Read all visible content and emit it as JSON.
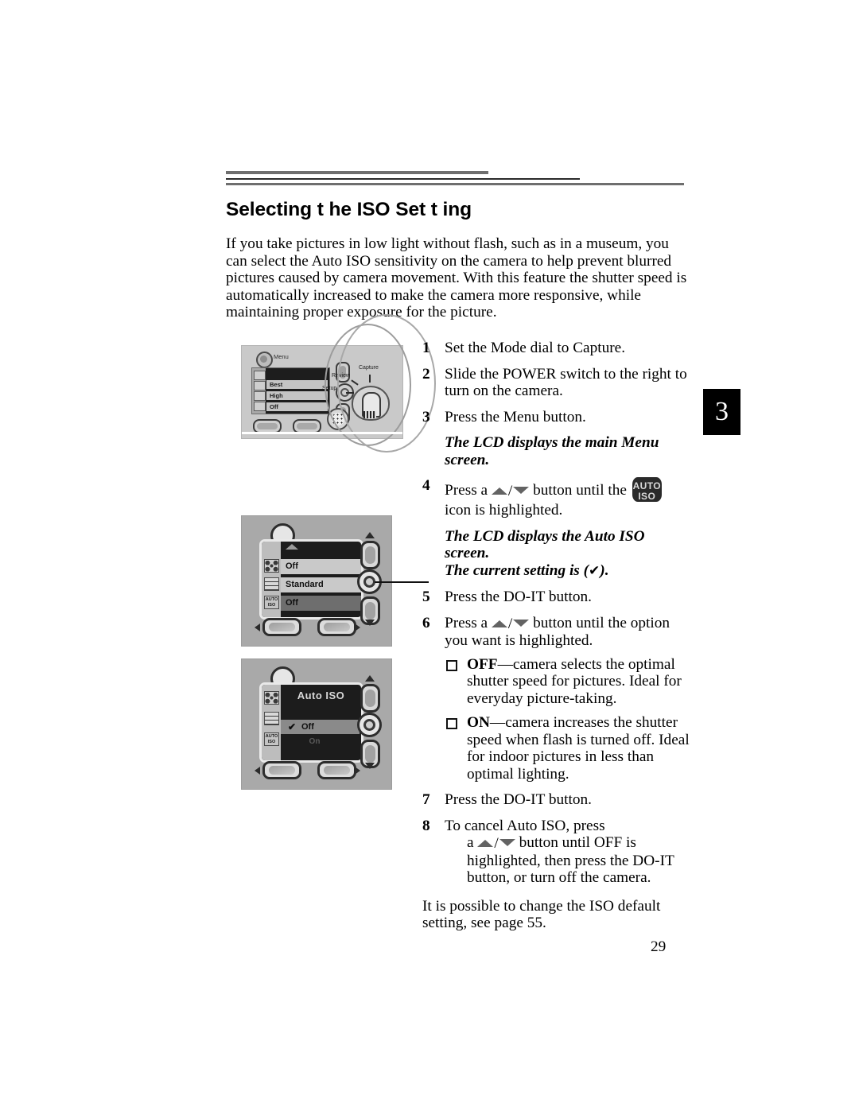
{
  "document": {
    "title": "Selecting t he ISO Set t ing",
    "page_number": "29",
    "chapter_tab": "3",
    "intro": "If you take pictures in low light without flash, such as in a museum, you can select the Auto ISO sensitivity on the camera to help prevent blurred pictures caused by camera movement. With this feature the shutter speed is automatically increased to make the camera more responsive, while maintaining proper exposure for the picture."
  },
  "steps": {
    "s1": {
      "num": "1",
      "text": "Set the Mode dial to Capture."
    },
    "s2": {
      "num": "2",
      "text": "Slide the POWER switch to the right to turn on the camera."
    },
    "s3": {
      "num": "3",
      "text": "Press the Menu button."
    },
    "note3": "The LCD displays the main Menu screen.",
    "s4": {
      "num": "4",
      "pre": "Press a",
      "mid": "button until the",
      "post": "icon is highlighted."
    },
    "note4a": "The LCD displays the Auto ISO screen.",
    "note4b_pre": "The current setting is (",
    "note4b_post": ").",
    "s5": {
      "num": "5",
      "text": "Press the DO-IT button."
    },
    "s6": {
      "num": "6",
      "pre": "Press a",
      "mid": "button until the option you want is highlighted."
    },
    "bullets": [
      {
        "label": "OFF",
        "text": "—camera selects the optimal shutter speed for pictures. Ideal for everyday picture-taking."
      },
      {
        "label": "ON",
        "text": "—camera increases the shutter speed when flash is turned off. Ideal for indoor pictures in less than optimal lighting."
      }
    ],
    "s7": {
      "num": "7",
      "text": "Press the DO-IT button."
    },
    "s8": {
      "num": "8",
      "text": "To cancel Auto ISO, press",
      "cont_pre": "a",
      "cont_post": "button until OFF is highlighted, then press the DO-IT button, or turn off the camera."
    },
    "closing": "It is possible to change the ISO default setting, see page 55."
  },
  "icons": {
    "iso_badge_line1": "AUTO",
    "iso_badge_line2": "ISO",
    "check_mark": "✔"
  },
  "figure_camera_back": {
    "menu_label": "Menu",
    "dial_labels": {
      "setup": "Setup",
      "review": "Review",
      "capture": "Capture"
    },
    "lcd_rows": [
      "Best",
      "High",
      "Off"
    ]
  },
  "figure_menu_screen": {
    "rows": [
      "Off",
      "Standard",
      "Off"
    ],
    "side_icons": [
      "flower",
      "grid",
      "auto-iso"
    ],
    "iso_icon_l1": "AUTO",
    "iso_icon_l2": "ISO"
  },
  "figure_autoiso_screen": {
    "title": "Auto ISO",
    "option_selected": "Off",
    "option_other": "On",
    "side_icons": [
      "flower",
      "grid",
      "auto-iso"
    ],
    "iso_icon_l1": "AUTO",
    "iso_icon_l2": "ISO"
  }
}
